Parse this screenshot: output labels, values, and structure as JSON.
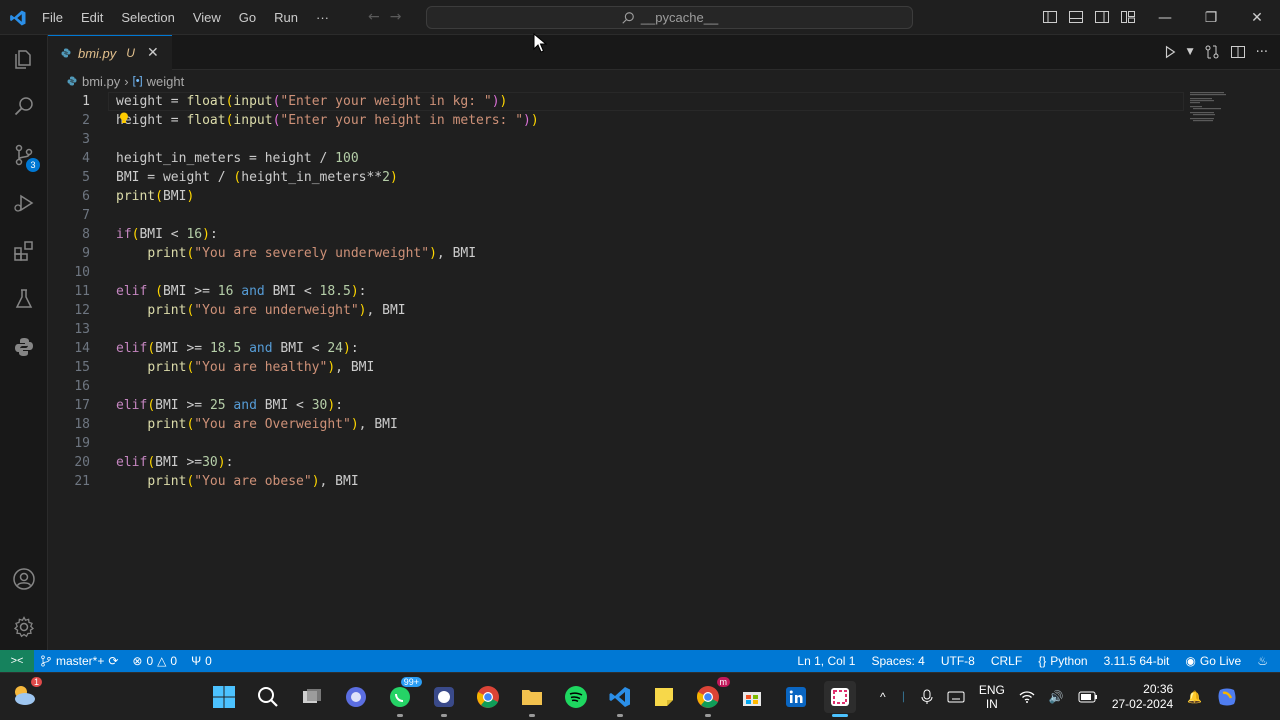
{
  "titlebar": {
    "menu": [
      "File",
      "Edit",
      "Selection",
      "View",
      "Go",
      "Run",
      "···"
    ],
    "search": "__pycache__"
  },
  "activitybar": {
    "scm_badge": "3"
  },
  "tab": {
    "label": "bmi.py",
    "modified": "U"
  },
  "breadcrumb": {
    "file": "bmi.py",
    "symbol": "weight"
  },
  "editor": {
    "line_numbers": [
      "1",
      "2",
      "3",
      "4",
      "5",
      "6",
      "7",
      "8",
      "9",
      "10",
      "11",
      "12",
      "13",
      "14",
      "15",
      "16",
      "17",
      "18",
      "19",
      "20",
      "21"
    ]
  },
  "statusbar": {
    "branch": "master*+",
    "errors": "0",
    "warnings": "0",
    "ports": "0",
    "position": "Ln 1, Col 1",
    "spaces": "Spaces: 4",
    "encoding": "UTF-8",
    "eol": "CRLF",
    "language": "Python",
    "interpreter": "3.11.5 64-bit",
    "golive": "Go Live"
  },
  "taskbar": {
    "weather_badge": "1",
    "whatsapp_badge": "99+",
    "chrome2_badge": "m",
    "lang1": "ENG",
    "lang2": "IN",
    "time": "20:36",
    "date": "27-02-2024"
  },
  "colors": {
    "accent": "#0078d4",
    "remote": "#16825d",
    "modified": "#e2c08d"
  }
}
